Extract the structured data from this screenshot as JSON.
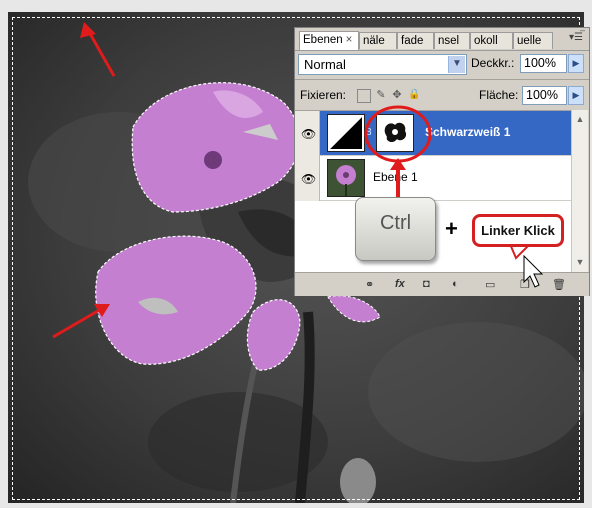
{
  "panel": {
    "tabs": [
      "Ebenen",
      "näle",
      "fade",
      "nsel",
      "okoll",
      "uelle"
    ],
    "tab_close": "×",
    "blend_mode": "Normal",
    "opacity_label": "Deckkr.:",
    "opacity_value": "100%",
    "lock_label": "Fixieren:",
    "fill_label": "Fläche:",
    "fill_value": "100%"
  },
  "layers": [
    {
      "name": "Schwarzweiß 1",
      "selected": true
    },
    {
      "name": "Ebene 1",
      "selected": false
    }
  ],
  "annotations": {
    "key_label": "Ctrl",
    "plus": "+",
    "callout": "Linker Klick"
  },
  "colors": {
    "selection_blue": "#3567c4",
    "flower_pink": "#c47fd1",
    "annotation_red": "#e01b1b"
  }
}
